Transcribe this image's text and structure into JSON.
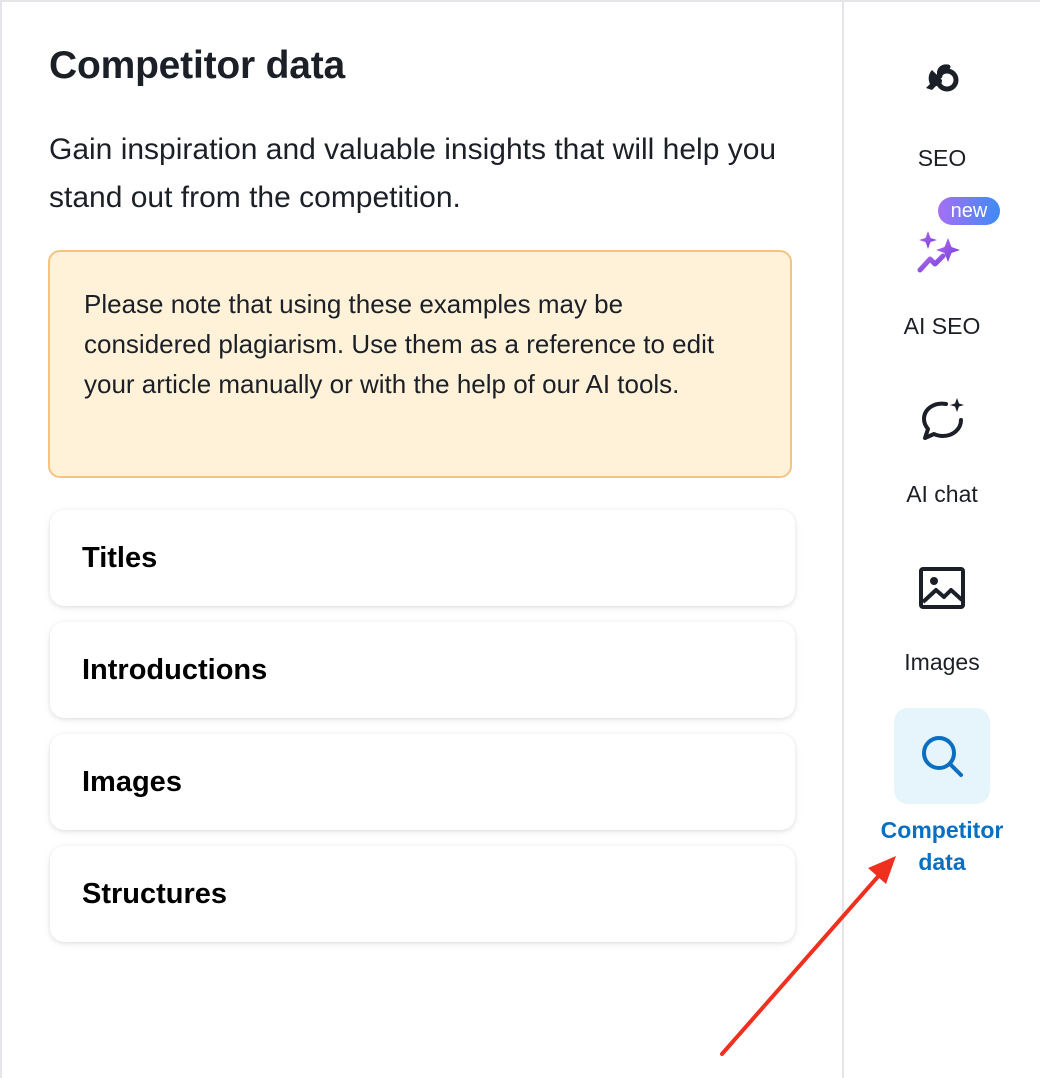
{
  "panel": {
    "title": "Competitor data",
    "description": "Gain inspiration and valuable insights that will help you stand out from the competition.",
    "note": "Please note that using these examples may be considered plagiarism. Use them as a reference to edit your article manually or with the help of our AI tools.",
    "sections": [
      {
        "label": "Titles"
      },
      {
        "label": "Introductions"
      },
      {
        "label": "Images"
      },
      {
        "label": "Structures"
      }
    ]
  },
  "sidebar": {
    "items": [
      {
        "label": "SEO",
        "icon": "seo-icon"
      },
      {
        "label": "AI SEO",
        "icon": "ai-sparkles-icon",
        "badge": "new"
      },
      {
        "label": "AI chat",
        "icon": "chat-bubble-sparkle-icon"
      },
      {
        "label": "Images",
        "icon": "image-icon"
      },
      {
        "label": "Competitor data",
        "icon": "search-icon",
        "active": true
      }
    ]
  },
  "colors": {
    "accent": "#0a6fc0",
    "active_bg": "#e6f4fc",
    "note_bg": "#fff2d9",
    "note_border": "#f5c483",
    "annotation_arrow": "#f0301f"
  }
}
